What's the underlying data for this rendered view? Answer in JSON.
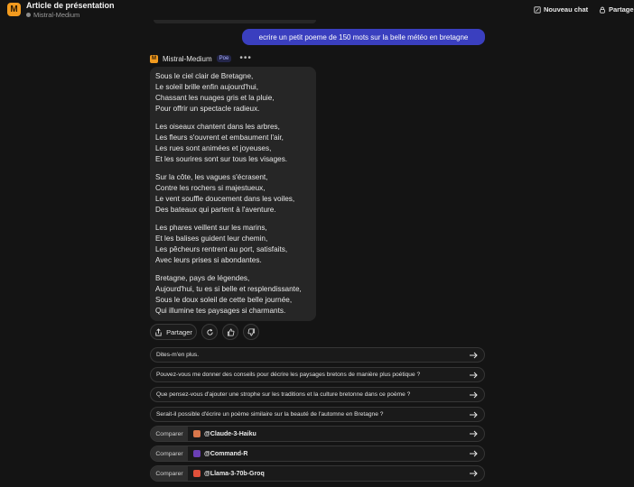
{
  "header": {
    "title": "Article de présentation",
    "subtitle": "Mistral-Medium",
    "new_chat": "Nouveau chat",
    "share": "Partager"
  },
  "user_message": "ecrire un petit poeme de 150 mots sur la belle météo en bretagne",
  "bot": {
    "name": "Mistral-Medium",
    "badge": "Poe",
    "more": "•••"
  },
  "poem": {
    "stanzas": [
      [
        "Sous le ciel clair de Bretagne,",
        "Le soleil brille enfin aujourd'hui,",
        "Chassant les nuages gris et la pluie,",
        "Pour offrir un spectacle radieux."
      ],
      [
        "Les oiseaux chantent dans les arbres,",
        "Les fleurs s'ouvrent et embaument l'air,",
        "Les rues sont animées et joyeuses,",
        "Et les sourires sont sur tous les visages."
      ],
      [
        "Sur la côte, les vagues s'écrasent,",
        "Contre les rochers si majestueux,",
        "Le vent souffle doucement dans les voiles,",
        "Des bateaux qui partent à l'aventure."
      ],
      [
        "Les phares veillent sur les marins,",
        "Et les balises guident leur chemin,",
        "Les pêcheurs rentrent au port, satisfaits,",
        "Avec leurs prises si abondantes."
      ],
      [
        "Bretagne, pays de légendes,",
        "Aujourd'hui, tu es si belle et resplendissante,",
        "Sous le doux soleil de cette belle journée,",
        "Qui illumine tes paysages si charmants."
      ]
    ]
  },
  "actions": {
    "share": "Partager"
  },
  "suggestions": [
    "Dites-m'en plus.",
    "Pouvez-vous me donner des conseils pour décrire les paysages bretons de manière plus poétique ?",
    "Que pensez-vous d'ajouter une strophe sur les traditions et la culture bretonne dans ce poème ?",
    "Serait-il possible d'écrire un poème similaire sur la beauté de l'automne en Bretagne ?"
  ],
  "compare": {
    "label": "Comparer",
    "bots": [
      {
        "name": "@Claude-3-Haiku",
        "color": "#d9774b"
      },
      {
        "name": "@Command-R",
        "color": "#6a3fb5"
      },
      {
        "name": "@Llama-3-70b-Groq",
        "color": "#e0503a"
      }
    ]
  },
  "colors": {
    "accent": "#3a3fbf",
    "brand": "#f29b1f"
  }
}
